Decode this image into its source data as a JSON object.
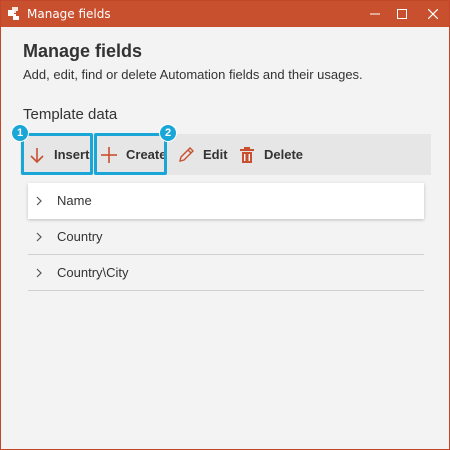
{
  "window": {
    "title": "Manage fields",
    "accent_color": "#c9502f",
    "highlight_color": "#1aa7d8"
  },
  "header": {
    "title": "Manage fields",
    "subtitle": "Add, edit, find or delete Automation fields and their usages."
  },
  "section": {
    "title": "Template data"
  },
  "toolbar": {
    "insert_label": "Insert",
    "create_label": "Create",
    "edit_label": "Edit",
    "delete_label": "Delete"
  },
  "badges": {
    "step1": "1",
    "step2": "2"
  },
  "tree": {
    "items": [
      {
        "label": "Name",
        "selected": true,
        "icon": "chevron-right-icon"
      },
      {
        "label": "Country",
        "selected": false,
        "icon": "chevron-right-icon"
      },
      {
        "label": "Country\\City",
        "selected": false,
        "icon": "chevron-right-icon"
      }
    ]
  }
}
